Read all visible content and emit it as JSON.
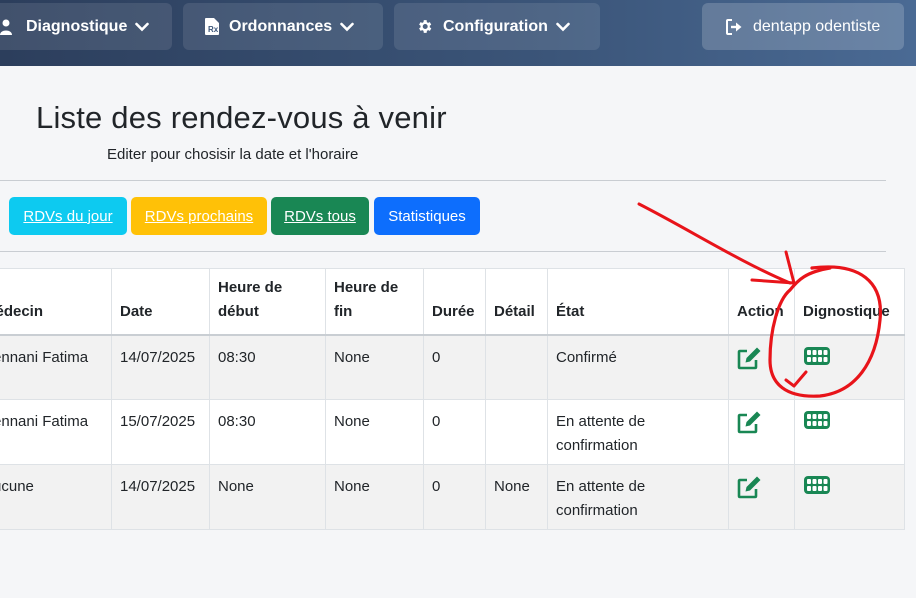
{
  "navbar": {
    "diagnostique": {
      "label": "Diagnostique",
      "icon": "user-doctor-icon"
    },
    "ordonnances": {
      "label": "Ordonnances",
      "icon": "prescription-file-icon"
    },
    "configuration": {
      "label": "Configuration",
      "icon": "gear-icon"
    },
    "logout": {
      "label": "dentapp odentiste",
      "icon": "sign-out-icon"
    }
  },
  "page": {
    "title": "Liste des rendez-vous à venir",
    "subtitle": "Editer pour chosisir la date et l'horaire"
  },
  "filters": {
    "jour": "RDVs du jour",
    "prochains": "RDVs prochains",
    "tous": "RDVs tous",
    "stats": "Statistiques"
  },
  "table": {
    "headers": {
      "medecin": "Médecin",
      "date": "Date",
      "heure_debut": "Heure de début",
      "heure_fin": "Heure de fin",
      "duree": "Durée",
      "detail": "Détail",
      "etat": "État",
      "action": "Action",
      "diagnostique": "Dignostique"
    },
    "rows": [
      {
        "medecin": "Bennani Fatima",
        "date": "14/07/2025",
        "heure_debut": "08:30",
        "heure_fin": "None",
        "duree": "0",
        "detail": "",
        "etat": "Confirmé"
      },
      {
        "medecin": "Bennani Fatima",
        "date": "15/07/2025",
        "heure_debut": "08:30",
        "heure_fin": "None",
        "duree": "0",
        "detail": "",
        "etat": "En attente de confirmation"
      },
      {
        "medecin": "Aucune",
        "date": "14/07/2025",
        "heure_debut": "None",
        "heure_fin": "None",
        "duree": "0",
        "detail": "None",
        "etat": "En attente de confirmation"
      }
    ],
    "action_icon": "edit-icon",
    "diagnostique_icon": "teeth-icon"
  },
  "colors": {
    "navbar": "#3b5579",
    "info": "#0dcaf0",
    "warning": "#ffc107",
    "success": "#198754",
    "primary": "#0d6efd",
    "icon_green": "#198754",
    "annotation": "#e8141a"
  }
}
